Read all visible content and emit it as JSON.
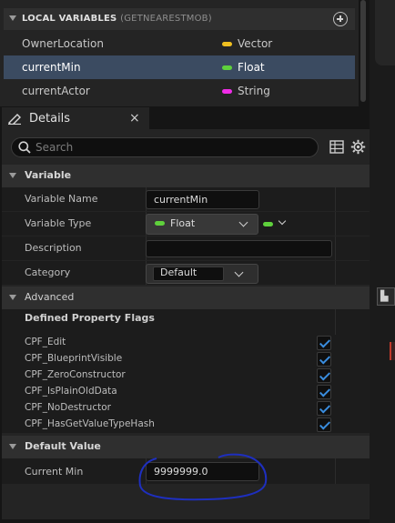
{
  "local_variables": {
    "title": "LOCAL VARIABLES",
    "scope": "(GETNEARESTMOB)",
    "rows": [
      {
        "name": "OwnerLocation",
        "type": "Vector",
        "color": "#f0c020"
      },
      {
        "name": "currentMin",
        "type": "Float",
        "color": "#5fd13c"
      },
      {
        "name": "currentActor",
        "type": "String",
        "color": "#f02ce8"
      }
    ]
  },
  "details_tab": {
    "label": "Details",
    "close": "×"
  },
  "search": {
    "placeholder": "Search"
  },
  "variable_section": {
    "title": "Variable",
    "variable_name_label": "Variable Name",
    "variable_name_value": "currentMin",
    "variable_type_label": "Variable Type",
    "variable_type_value": "Float",
    "description_label": "Description",
    "description_value": "",
    "category_label": "Category",
    "category_value": "Default"
  },
  "advanced_section": {
    "title": "Advanced",
    "flags_header": "Defined Property Flags",
    "flags": [
      {
        "label": "CPF_Edit",
        "checked": true
      },
      {
        "label": "CPF_BlueprintVisible",
        "checked": true
      },
      {
        "label": "CPF_ZeroConstructor",
        "checked": true
      },
      {
        "label": "CPF_IsPlainOldData",
        "checked": true
      },
      {
        "label": "CPF_NoDestructor",
        "checked": true
      },
      {
        "label": "CPF_HasGetValueTypeHash",
        "checked": true
      }
    ]
  },
  "default_value_section": {
    "title": "Default Value",
    "current_min_label": "Current Min",
    "current_min_value": "9999999.0"
  },
  "colors": {
    "float_pin": "#5fd13c",
    "selection": "#3b4b61",
    "checkmark": "#3a8dde",
    "annotation": "#1e2fbf"
  }
}
